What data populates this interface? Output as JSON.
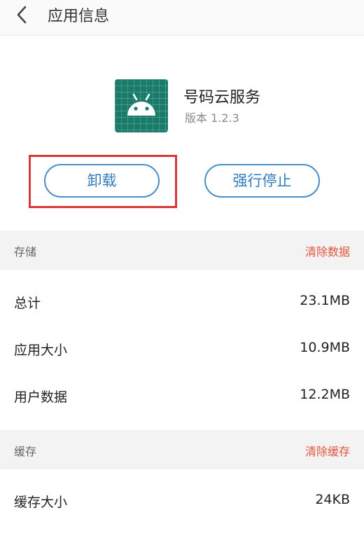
{
  "header": {
    "title": "应用信息"
  },
  "app": {
    "name": "号码云服务",
    "version": "版本 1.2.3",
    "icon": "android-icon",
    "icon_color": "#1a7b6b"
  },
  "actions": {
    "uninstall_label": "卸载",
    "force_stop_label": "强行停止"
  },
  "storage": {
    "title": "存储",
    "clear_label": "清除数据",
    "rows": [
      {
        "label": "总计",
        "value": "23.1MB"
      },
      {
        "label": "应用大小",
        "value": "10.9MB"
      },
      {
        "label": "用户数据",
        "value": "12.2MB"
      }
    ]
  },
  "cache": {
    "title": "缓存",
    "clear_label": "清除缓存",
    "rows": [
      {
        "label": "缓存大小",
        "value": "24KB"
      }
    ]
  },
  "colors": {
    "accent_button": "#2f7bbd",
    "action_red": "#e2533e",
    "highlight_red": "#d9383a"
  }
}
